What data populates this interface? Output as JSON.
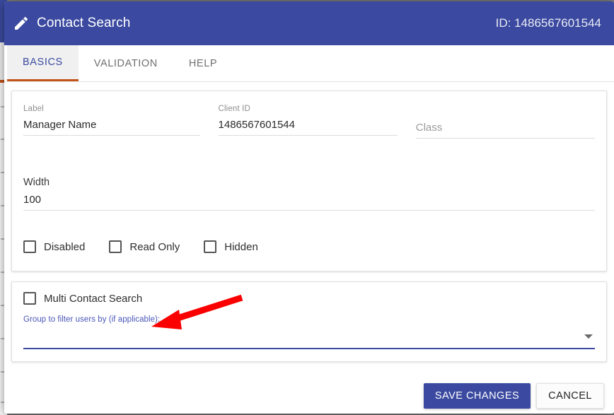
{
  "header": {
    "icon": "pencil-icon",
    "title": "Contact Search",
    "id_text": "ID: 1486567601544",
    "background_color": "#3b4aa0"
  },
  "tabs": [
    {
      "label": "BASICS",
      "active": true
    },
    {
      "label": "VALIDATION",
      "active": false
    },
    {
      "label": "HELP",
      "active": false
    }
  ],
  "tabs_active_indicator_color": "#c4531a",
  "form": {
    "label_field": {
      "label": "Label",
      "value": "Manager Name",
      "placeholder": "Label"
    },
    "client_id_field": {
      "label": "Client ID",
      "value": "1486567601544",
      "placeholder": "Client ID"
    },
    "class_field": {
      "label": "",
      "value": "",
      "placeholder": "Class"
    },
    "width_field": {
      "label": "Width",
      "value": "100",
      "placeholder": "Width"
    },
    "checkboxes": [
      {
        "label": "Disabled",
        "checked": false
      },
      {
        "label": "Read Only",
        "checked": false
      },
      {
        "label": "Hidden",
        "checked": false
      }
    ]
  },
  "multi_section": {
    "checkbox": {
      "label": "Multi Contact Search",
      "checked": false
    },
    "group_label": "Group to filter users by (if applicable):",
    "select_value": "",
    "select_caret": "chevron-down-icon",
    "underline_color": "#3b4aa0"
  },
  "footer": {
    "save_label": "SAVE CHANGES",
    "cancel_label": "CANCEL",
    "save_color": "#3b4aa0"
  },
  "annotation": {
    "arrow_color": "#fa0000",
    "arrow_tip": "217,462",
    "arrow_tail": "342,421"
  }
}
